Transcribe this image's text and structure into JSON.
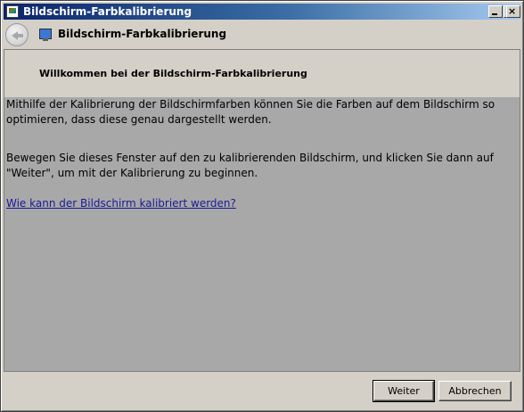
{
  "window": {
    "title": "Bildschirm-Farbkalibrierung",
    "controls": {
      "minimize": "_",
      "maximize": "□",
      "close": "×"
    }
  },
  "nav": {
    "title": "Bildschirm-Farbkalibrierung",
    "back_icon": "back-arrow-icon",
    "app_icon": "monitor-icon"
  },
  "content": {
    "header": "Willkommen bei der Bildschirm-Farbkalibrierung",
    "paragraph1": "Mithilfe der Kalibrierung der Bildschirmfarben können Sie die Farben auf dem Bildschirm so optimieren, dass diese genau dargestellt werden.",
    "paragraph2": "Bewegen Sie dieses Fenster auf den zu kalibrierenden Bildschirm, und klicken Sie dann auf \"Weiter\", um mit der Kalibrierung zu beginnen.",
    "help_link": "Wie kann der Bildschirm kalibriert werden?"
  },
  "footer": {
    "next_label": "Weiter",
    "cancel_label": "Abbrechen"
  },
  "colors": {
    "titlebar_start": "#0a246a",
    "titlebar_end": "#a6caf0",
    "content_bg": "#a8a8a8",
    "face": "#d4d0c8",
    "link": "#1a1a9a"
  }
}
